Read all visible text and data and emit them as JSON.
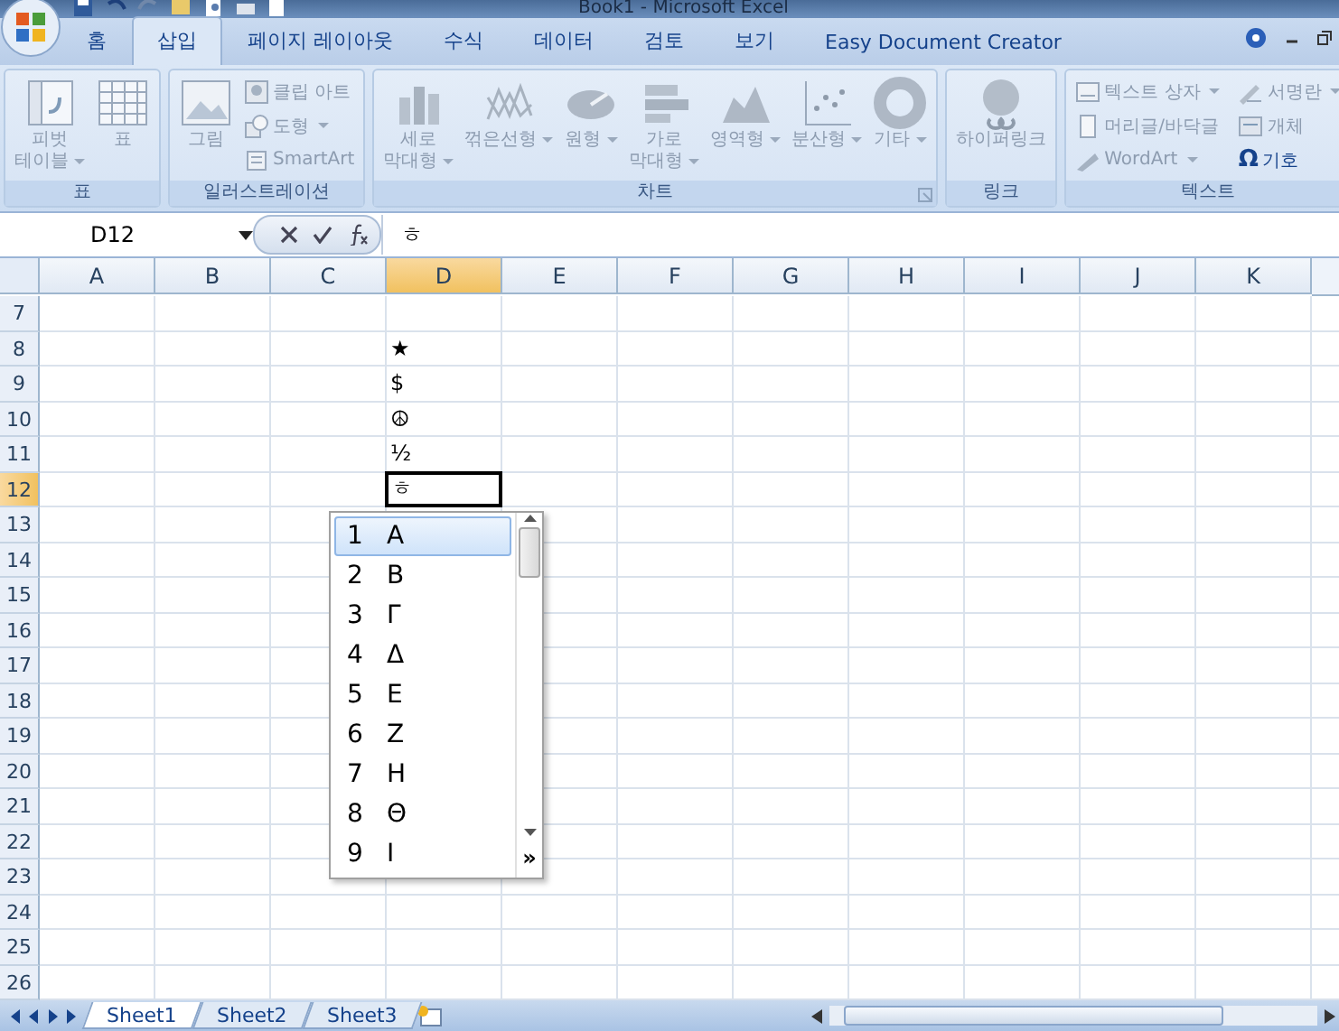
{
  "window": {
    "title": "Book1 - Microsoft Excel"
  },
  "tabs": [
    {
      "label": "홈",
      "selected": false
    },
    {
      "label": "삽입",
      "selected": true
    },
    {
      "label": "페이지 레이아웃",
      "selected": false
    },
    {
      "label": "수식",
      "selected": false
    },
    {
      "label": "데이터",
      "selected": false
    },
    {
      "label": "검토",
      "selected": false
    },
    {
      "label": "보기",
      "selected": false
    },
    {
      "label": "Easy Document Creator",
      "selected": false
    }
  ],
  "ribbon": [
    {
      "label": "표",
      "launcher": false,
      "buttons": [
        {
          "kind": "large",
          "lines": [
            "피벗",
            "테이블"
          ],
          "dropdown": true,
          "disabled": true
        },
        {
          "kind": "large",
          "lines": [
            "표"
          ],
          "dropdown": false,
          "disabled": true
        }
      ]
    },
    {
      "label": "일러스트레이션",
      "launcher": false,
      "buttons": [
        {
          "kind": "large",
          "lines": [
            "그림"
          ],
          "dropdown": false,
          "disabled": true
        },
        {
          "kind": "small",
          "lines": [
            "클립 아트"
          ],
          "dropdown": false,
          "disabled": true
        },
        {
          "kind": "small",
          "lines": [
            "도형"
          ],
          "dropdown": true,
          "disabled": true
        },
        {
          "kind": "small",
          "lines": [
            "SmartArt"
          ],
          "dropdown": false,
          "disabled": true
        }
      ]
    },
    {
      "label": "차트",
      "launcher": true,
      "buttons": [
        {
          "kind": "large",
          "lines": [
            "세로",
            "막대형"
          ],
          "dropdown": true,
          "disabled": true
        },
        {
          "kind": "large",
          "lines": [
            "꺾은선형"
          ],
          "dropdown": true,
          "disabled": true
        },
        {
          "kind": "large",
          "lines": [
            "원형"
          ],
          "dropdown": true,
          "disabled": true
        },
        {
          "kind": "large",
          "lines": [
            "가로",
            "막대형"
          ],
          "dropdown": true,
          "disabled": true
        },
        {
          "kind": "large",
          "lines": [
            "영역형"
          ],
          "dropdown": true,
          "disabled": true
        },
        {
          "kind": "large",
          "lines": [
            "분산형"
          ],
          "dropdown": true,
          "disabled": true
        },
        {
          "kind": "large",
          "lines": [
            "기타"
          ],
          "dropdown": true,
          "disabled": true
        }
      ]
    },
    {
      "label": "링크",
      "launcher": false,
      "buttons": [
        {
          "kind": "large",
          "lines": [
            "하이퍼링크"
          ],
          "dropdown": false,
          "disabled": true
        }
      ]
    },
    {
      "label": "텍스트",
      "launcher": false,
      "buttons": [
        {
          "kind": "small",
          "lines": [
            "텍스트 상자"
          ],
          "dropdown": true,
          "disabled": true
        },
        {
          "kind": "small",
          "lines": [
            "머리글/바닥글"
          ],
          "dropdown": false,
          "disabled": true
        },
        {
          "kind": "small",
          "lines": [
            "WordArt"
          ],
          "dropdown": true,
          "disabled": true
        },
        {
          "kind": "small",
          "lines": [
            "서명란"
          ],
          "dropdown": true,
          "disabled": true
        },
        {
          "kind": "small",
          "lines": [
            "개체"
          ],
          "dropdown": false,
          "disabled": true
        },
        {
          "kind": "symbol",
          "symbol": "Ω",
          "lines": [
            "기호"
          ],
          "dropdown": false,
          "disabled": false
        }
      ]
    }
  ],
  "formula_bar": {
    "name_box": "D12",
    "value": "ㅎ"
  },
  "sheet": {
    "columns": [
      {
        "label": "A",
        "selected": false
      },
      {
        "label": "B",
        "selected": false
      },
      {
        "label": "C",
        "selected": false
      },
      {
        "label": "D",
        "selected": true
      },
      {
        "label": "E",
        "selected": false
      },
      {
        "label": "F",
        "selected": false
      },
      {
        "label": "G",
        "selected": false
      },
      {
        "label": "H",
        "selected": false
      },
      {
        "label": "I",
        "selected": false
      },
      {
        "label": "J",
        "selected": false
      },
      {
        "label": "K",
        "selected": false
      }
    ],
    "rows": [
      {
        "label": "7",
        "selected": false
      },
      {
        "label": "8",
        "selected": false,
        "column_d": "★"
      },
      {
        "label": "9",
        "selected": false,
        "column_d": "$"
      },
      {
        "label": "10",
        "selected": false,
        "column_d": "☮"
      },
      {
        "label": "11",
        "selected": false,
        "column_d": "½"
      },
      {
        "label": "12",
        "selected": true,
        "column_d": "ㅎ"
      },
      {
        "label": "13",
        "selected": false
      },
      {
        "label": "14",
        "selected": false
      },
      {
        "label": "15",
        "selected": false
      },
      {
        "label": "16",
        "selected": false
      },
      {
        "label": "17",
        "selected": false
      },
      {
        "label": "18",
        "selected": false
      },
      {
        "label": "19",
        "selected": false
      },
      {
        "label": "20",
        "selected": false
      },
      {
        "label": "21",
        "selected": false
      },
      {
        "label": "22",
        "selected": false
      },
      {
        "label": "23",
        "selected": false
      },
      {
        "label": "24",
        "selected": false
      },
      {
        "label": "25",
        "selected": false
      },
      {
        "label": "26",
        "selected": false
      }
    ]
  },
  "candidates": {
    "items": [
      {
        "number": "1",
        "char": "Α",
        "selected": true
      },
      {
        "number": "2",
        "char": "Β",
        "selected": false
      },
      {
        "number": "3",
        "char": "Γ",
        "selected": false
      },
      {
        "number": "4",
        "char": "Δ",
        "selected": false
      },
      {
        "number": "5",
        "char": "Ε",
        "selected": false
      },
      {
        "number": "6",
        "char": "Ζ",
        "selected": false
      },
      {
        "number": "7",
        "char": "Η",
        "selected": false
      },
      {
        "number": "8",
        "char": "Θ",
        "selected": false
      },
      {
        "number": "9",
        "char": "Ι",
        "selected": false
      }
    ],
    "more": "»"
  },
  "sheet_tabs": [
    {
      "label": "Sheet1",
      "selected": true
    },
    {
      "label": "Sheet2",
      "selected": false
    },
    {
      "label": "Sheet3",
      "selected": false
    }
  ]
}
